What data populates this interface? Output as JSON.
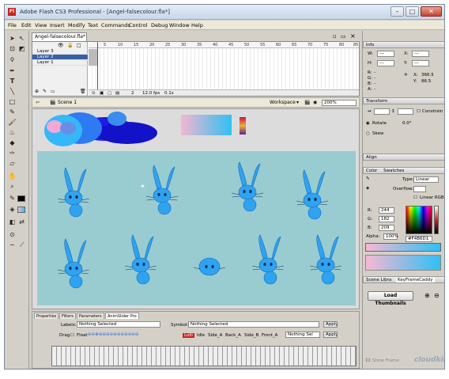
{
  "window": {
    "title": "Adobe Flash CS3 Professional - [Angel-falsecolour.fla*]",
    "app_badge": "Fl"
  },
  "menu": [
    "File",
    "Edit",
    "View",
    "Insert",
    "Modify",
    "Text",
    "Commands",
    "Control",
    "Debug",
    "Window",
    "Help"
  ],
  "document": {
    "tab": "Angel-falsecolour.fla*",
    "layers": [
      "Layer 3",
      "Layer 2",
      "Layer 1"
    ],
    "frame_numbers": [
      "5",
      "10",
      "15",
      "20",
      "25",
      "30",
      "35",
      "40",
      "45",
      "50",
      "55",
      "60",
      "65",
      "70",
      "75",
      "80",
      "85"
    ],
    "current_frame": "2",
    "fps": "12.0 fps",
    "time": "0.1s",
    "scene": "Scene 1",
    "workspace": "Workspace",
    "zoom": "200%"
  },
  "bottom_panel": {
    "tabs": [
      "Properties",
      "Filters",
      "Parameters",
      "AnimSlider Pro"
    ],
    "labels_label": "Labels:",
    "labels_value": "Nothing Selected",
    "symbol_label": "Symbol:",
    "symbol_value": "Nothing Selected",
    "apply": "Apply",
    "drag_label": "Drag",
    "float_label": "Float",
    "frame_chips": [
      "Lolli",
      "Idle",
      "Side_A",
      "Back_A",
      "Side_B",
      "Front_A"
    ],
    "select_value": "Nothing Sel"
  },
  "info_panel": {
    "title": "Info",
    "w_label": "W:",
    "h_label": "H:",
    "x_label": "X:",
    "y_label": "Y:",
    "w_value": "---",
    "h_value": "---",
    "x_value": "---",
    "y_value": "---",
    "r_label": "R:",
    "g_label": "G:",
    "b_label": "B:",
    "a_label": "A:",
    "r_value": "-",
    "g_value": "-",
    "b_value": "-",
    "a_value": "-",
    "x2_label": "X:",
    "y2_label": "Y:",
    "cursor_x": "366.5",
    "cursor_y": "86.5"
  },
  "transform_panel": {
    "title": "Transform",
    "constrain": "Constrain",
    "rotate": "Rotate",
    "skew": "Skew",
    "rotate_value": "0.0°"
  },
  "align_panel": {
    "title": "Align"
  },
  "color_panel": {
    "tabs": [
      "Color",
      "Swatches"
    ],
    "type_label": "Type:",
    "type_value": "Linear",
    "overflow_label": "Overflow:",
    "linear_rgb": "Linear RGB",
    "r_label": "R:",
    "g_label": "G:",
    "b_label": "B:",
    "alpha_label": "Alpha:",
    "r": "244",
    "g": "182",
    "b": "209",
    "alpha": "100%",
    "hex": "#F4B6D1"
  },
  "library_panel": {
    "tabs": [
      "Scene Libra",
      "KeyFrameCaddy"
    ],
    "load_button": "Load Thumbnails",
    "show_frames": "Show Frame"
  },
  "watermark": "cloudkir",
  "colors": {
    "stage": "#99CCD0",
    "bunny": "#2FA3F0",
    "accent": "#3A5FA8"
  }
}
